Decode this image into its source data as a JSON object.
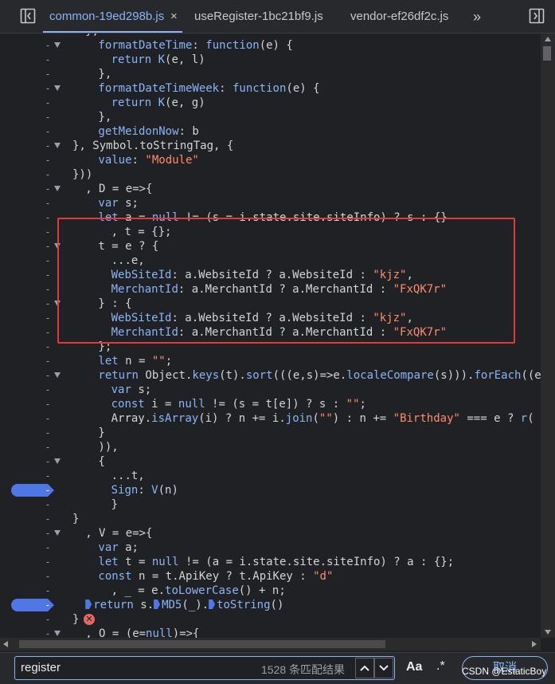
{
  "tabs": [
    {
      "label": "common-19ed298b.js",
      "active": true,
      "close": "×"
    },
    {
      "label": "useRegister-1bc21bf9.js",
      "active": false
    },
    {
      "label": "vendor-ef26df2c.js",
      "active": false
    }
  ],
  "tabbar": {
    "more": "»"
  },
  "code_lines": [
    {
      "text": "},",
      "gutter": "-",
      "fold": true
    },
    {
      "text": "formatDateTime: function(e) {",
      "gutter": "-",
      "fold": true
    },
    {
      "text": "return K(e, l)",
      "gutter": "-"
    },
    {
      "text": "},",
      "gutter": "-"
    },
    {
      "text": "formatDateTimeWeek: function(e) {",
      "gutter": "-",
      "fold": true
    },
    {
      "text": "return K(e, g)",
      "gutter": "-"
    },
    {
      "text": "},",
      "gutter": "-"
    },
    {
      "text": "getMeidonNow: b",
      "gutter": "-"
    },
    {
      "text": "}, Symbol.toStringTag, {",
      "gutter": "-",
      "fold": true
    },
    {
      "text": "value: \"Module\"",
      "gutter": "-"
    },
    {
      "text": "}))",
      "gutter": "-"
    },
    {
      "text": ", D = e=>{",
      "gutter": "-",
      "fold": true
    },
    {
      "text": "var s;",
      "gutter": "-"
    },
    {
      "text": "let a = null != (s = i.state.site.siteInfo) ? s : {}",
      "gutter": "-"
    },
    {
      "text": ", t = {};",
      "gutter": "-"
    },
    {
      "text": "t = e ? {",
      "gutter": "-",
      "fold": true
    },
    {
      "text": "...e,",
      "gutter": "-"
    },
    {
      "text": "WebSiteId: a.WebsiteId ? a.WebsiteId : \"kjz\",",
      "gutter": "-"
    },
    {
      "text": "MerchantId: a.MerchantId ? a.MerchantId : \"FxQK7r\"",
      "gutter": "-"
    },
    {
      "text": "} : {",
      "gutter": "-",
      "fold": true
    },
    {
      "text": "WebSiteId: a.WebsiteId ? a.WebsiteId : \"kjz\",",
      "gutter": "-"
    },
    {
      "text": "MerchantId: a.MerchantId ? a.MerchantId : \"FxQK7r\"",
      "gutter": "-"
    },
    {
      "text": "};",
      "gutter": "-"
    },
    {
      "text": "let n = \"\";",
      "gutter": "-"
    },
    {
      "text": "return Object.keys(t).sort(((e,s)=>e.localeCompare(s))).forEach((e=",
      "gutter": "-",
      "fold": true
    },
    {
      "text": "var s;",
      "gutter": "-"
    },
    {
      "text": "const i = null != (s = t[e]) ? s : \"\";",
      "gutter": "-"
    },
    {
      "text": "Array.isArray(i) ? n += i.join(\"\") : n += \"Birthday\" === e ? r(",
      "gutter": "-"
    },
    {
      "text": "}",
      "gutter": "-"
    },
    {
      "text": ")),",
      "gutter": "-"
    },
    {
      "text": "{",
      "gutter": "-",
      "fold": true
    },
    {
      "text": "...t,",
      "gutter": "-"
    },
    {
      "text": "Sign: V(n)",
      "gutter": "-",
      "breakpoint": true
    },
    {
      "text": "}",
      "gutter": "-"
    },
    {
      "text": "}",
      "gutter": "-"
    },
    {
      "text": ", V = e=>{",
      "gutter": "-",
      "fold": true
    },
    {
      "text": "var a;",
      "gutter": "-"
    },
    {
      "text": "let t = null != (a = i.state.site.siteInfo) ? a : {};",
      "gutter": "-"
    },
    {
      "text": "const n = t.ApiKey ? t.ApiKey : \"d\"",
      "gutter": "-"
    },
    {
      "text": ", _ = e.toLowerCase() + n;",
      "gutter": "-"
    },
    {
      "text": "return s.MD5(_).toString()",
      "gutter": "-",
      "breakpoint": true
    },
    {
      "text": "}",
      "gutter": "-"
    },
    {
      "text": ", O = (e=null)=>{",
      "gutter": "-",
      "fold": true
    }
  ],
  "error_icon": "✕",
  "search": {
    "value": "register",
    "match_count": "1528 条匹配结果",
    "prev": "︿",
    "next": "﹀",
    "match_case": "Aa",
    "regex": ".*",
    "cancel": "取消"
  },
  "watermark": "CSDN @EstaticBoy",
  "colors": {
    "accent": "#8ab4f8",
    "highlight_box": "#e53935",
    "breakpoint": "#4e78e6"
  }
}
